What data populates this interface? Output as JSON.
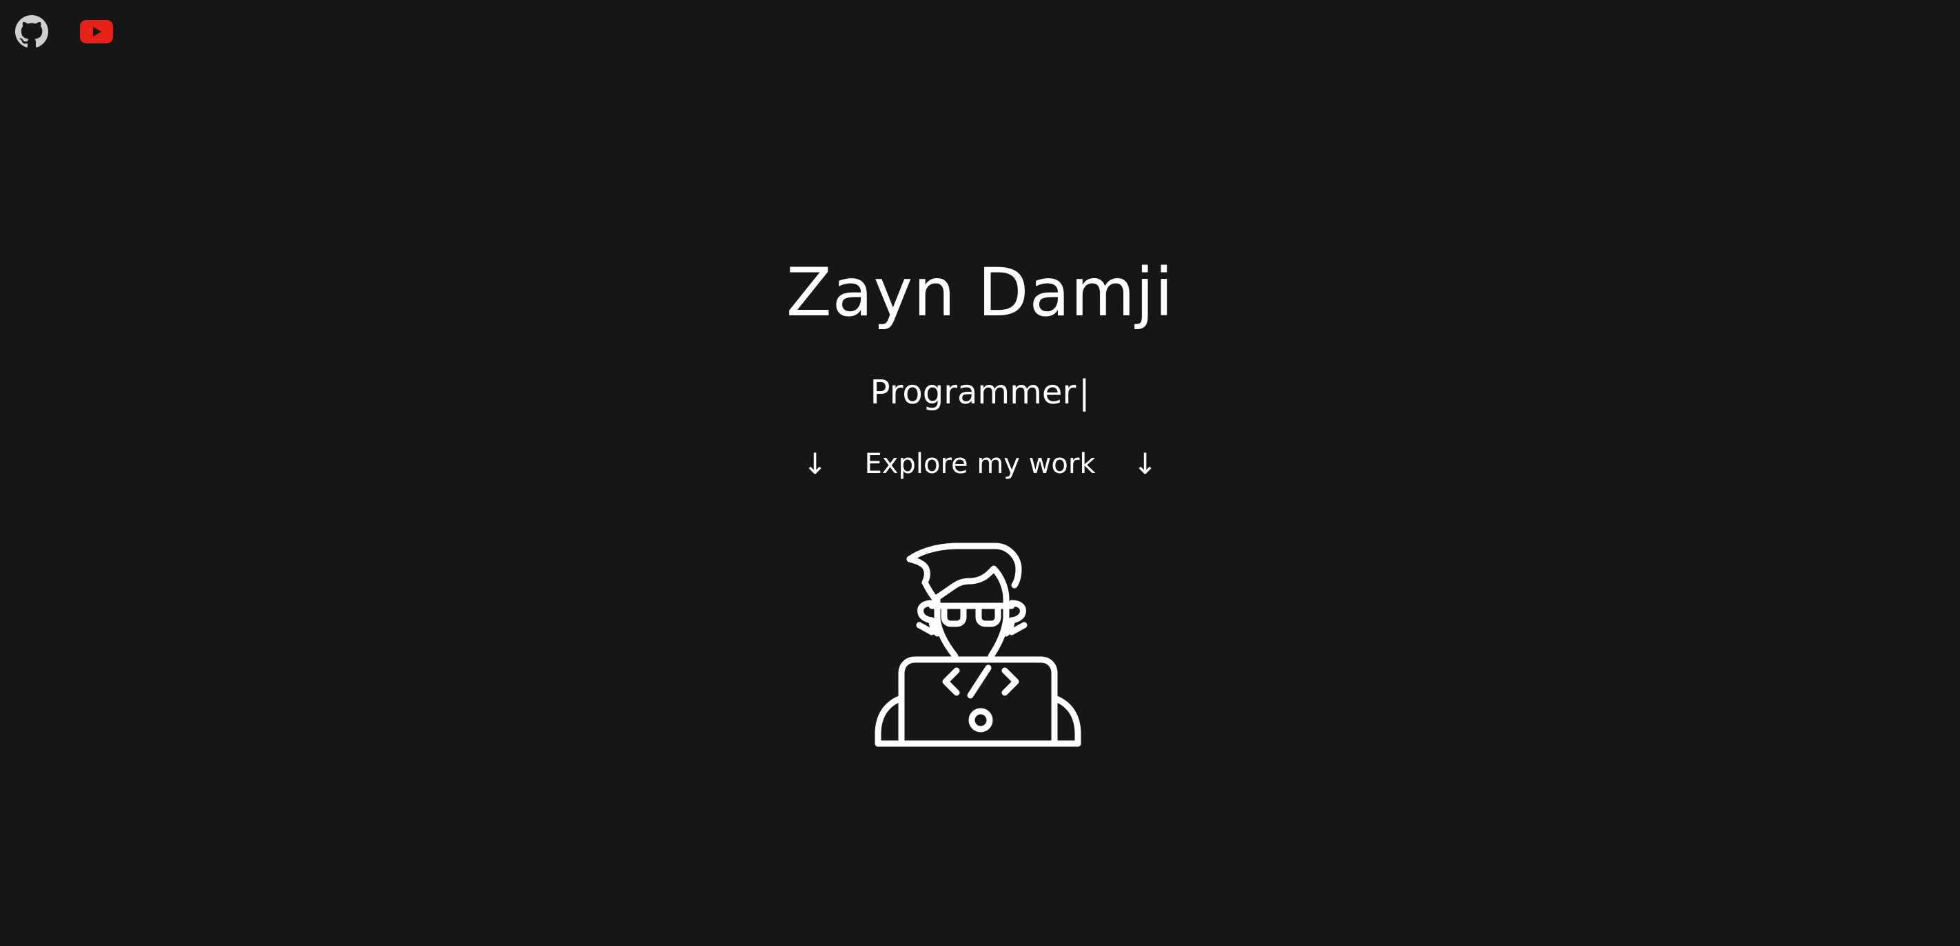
{
  "social": {
    "github": {
      "icon": "github-icon"
    },
    "youtube": {
      "icon": "youtube-icon",
      "color": "#e62117"
    }
  },
  "hero": {
    "name": "Zayn Damji",
    "role": "Programmer",
    "cursor": "|",
    "explore": {
      "label": "Explore my work",
      "left_arrow": "↓",
      "right_arrow": "↓"
    },
    "illustration": {
      "icon": "programmer-avatar-icon"
    }
  },
  "colors": {
    "background": "#161616",
    "text": "#ffffff",
    "github": "#cfcfcf",
    "youtube": "#e62117"
  }
}
